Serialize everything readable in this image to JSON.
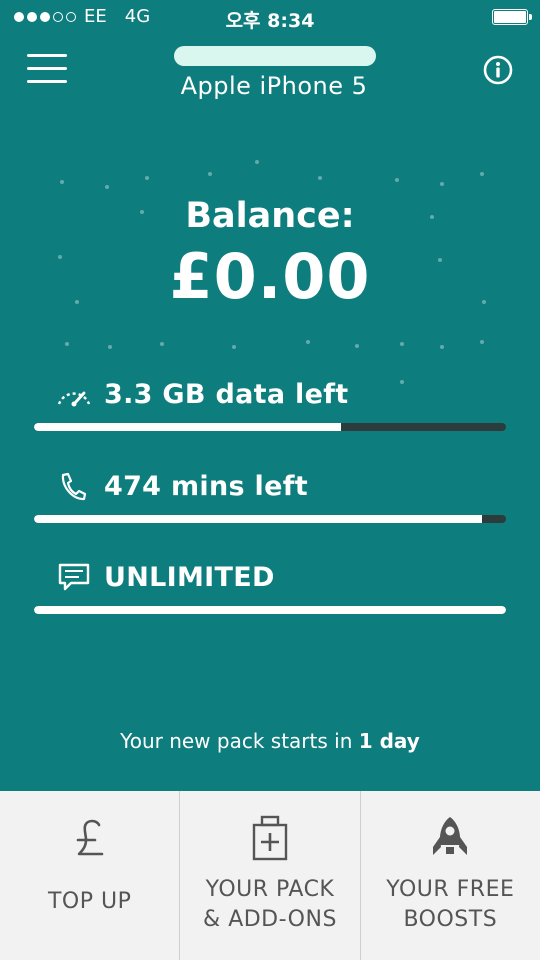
{
  "status_bar": {
    "carrier": "EE",
    "network": "4G",
    "time": "오후 8:34",
    "signal_filled": 3,
    "signal_total": 5
  },
  "header": {
    "device_name": "Apple iPhone 5",
    "menu_icon": "hamburger-icon",
    "info_icon": "info-icon"
  },
  "balance": {
    "label": "Balance:",
    "value": "£0.00"
  },
  "allowances": [
    {
      "icon": "gauge-icon",
      "label": "3.3 GB data left",
      "remaining_fraction": 0.65
    },
    {
      "icon": "phone-icon",
      "label": "474 mins left",
      "remaining_fraction": 0.95
    },
    {
      "icon": "message-icon",
      "label": "UNLIMITED",
      "remaining_fraction": 1.0
    }
  ],
  "pack_note": {
    "prefix": "Your new pack starts in",
    "emphasis": "1 day"
  },
  "bottom_nav": [
    {
      "icon": "pound-icon",
      "line1": "TOP UP",
      "line2": ""
    },
    {
      "icon": "medkit-icon",
      "line1": "YOUR PACK",
      "line2": "& ADD-ONS"
    },
    {
      "icon": "rocket-icon",
      "line1": "YOUR FREE",
      "line2": "BOOSTS"
    }
  ],
  "colors": {
    "background": "#0E7D7E",
    "bar_fill": "#FFFFFF",
    "bar_track": "#2C3B3C",
    "nav_background": "#F2F2F2",
    "nav_text": "#555555"
  }
}
